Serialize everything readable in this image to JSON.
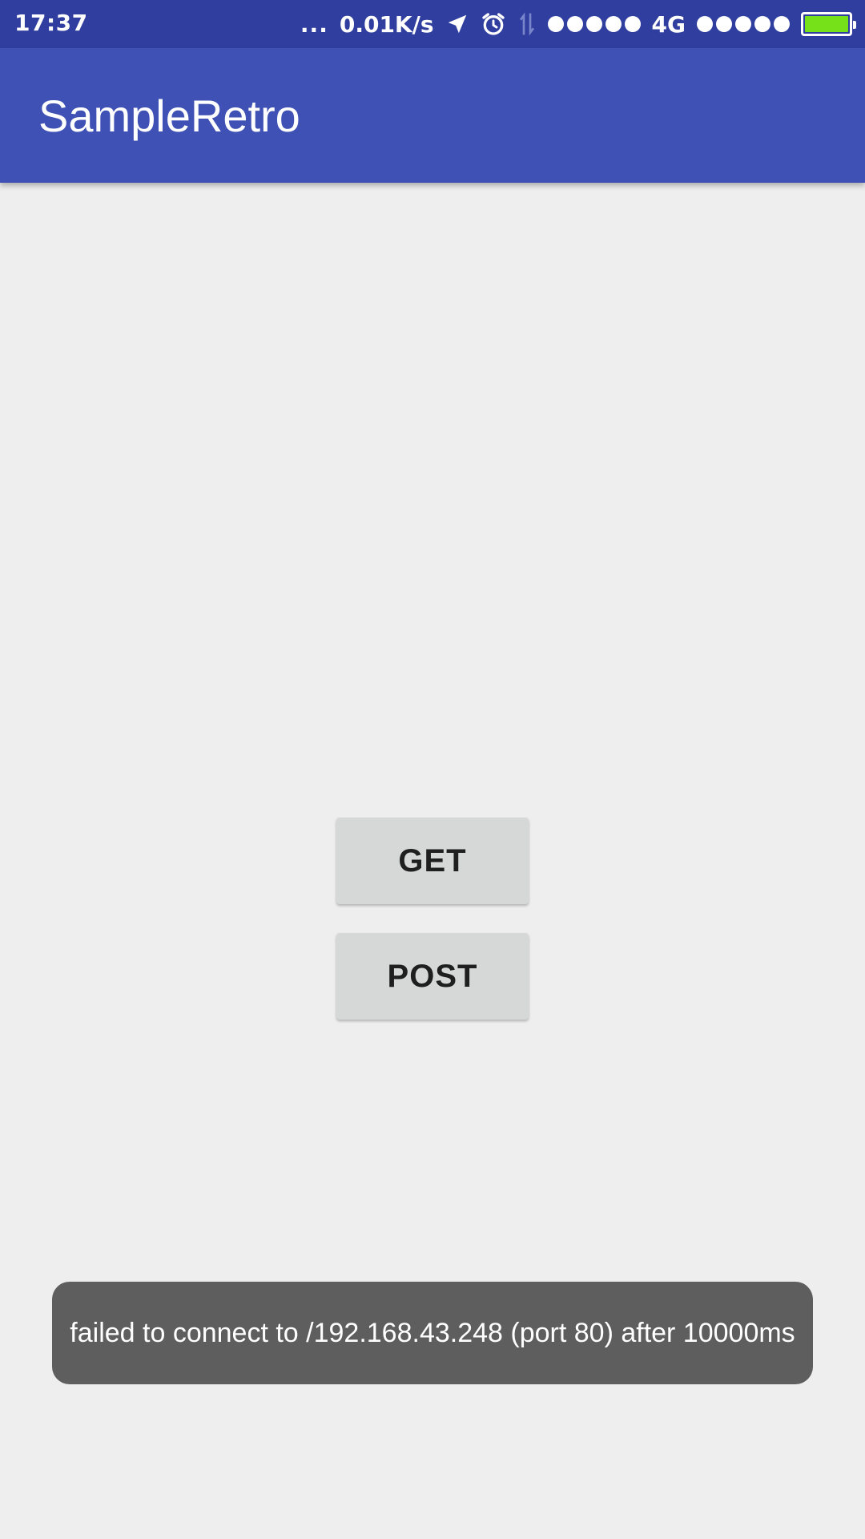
{
  "status_bar": {
    "time": "17:37",
    "more_indicator": "...",
    "net_speed": "0.01K/s",
    "icons": [
      "location-arrow-icon",
      "alarm-icon",
      "data-transfer-icon"
    ],
    "sim1_network": "4G",
    "battery_color": "#76e018"
  },
  "app_bar": {
    "title": "SampleRetro",
    "color": "#3f51b5"
  },
  "main": {
    "get_label": "GET",
    "post_label": "POST"
  },
  "toast": {
    "message": "failed to connect to /192.168.43.248 (port 80) after 10000ms"
  }
}
